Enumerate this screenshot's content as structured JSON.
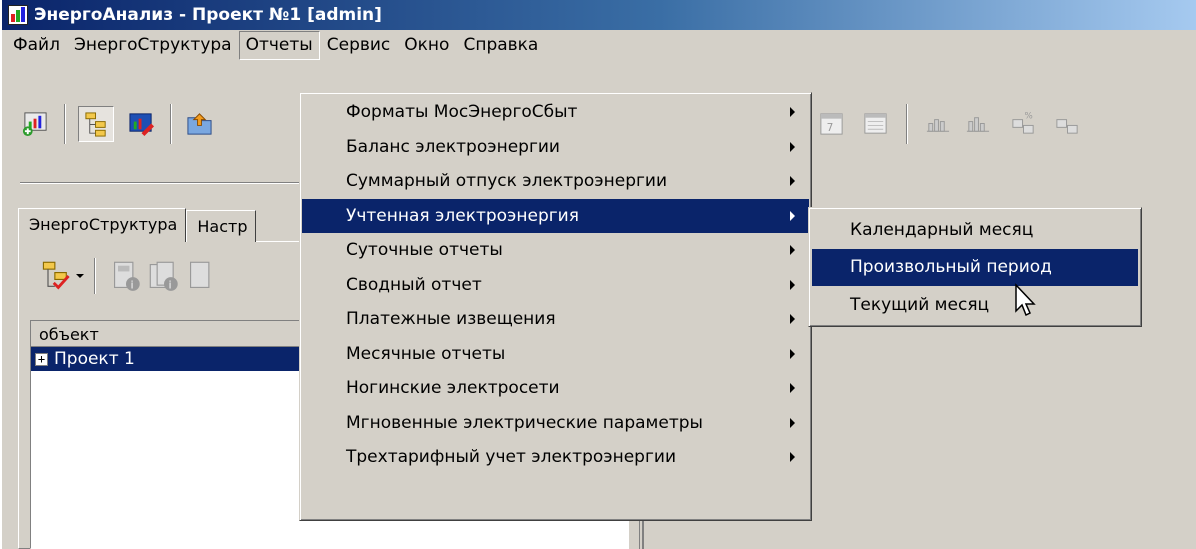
{
  "window": {
    "title": "ЭнергоАнализ - Проект №1 [admin]"
  },
  "menubar": [
    {
      "label": "Файл"
    },
    {
      "label": "ЭнергоСтруктура"
    },
    {
      "label": "Отчеты"
    },
    {
      "label": "Сервис"
    },
    {
      "label": "Окно"
    },
    {
      "label": "Справка"
    }
  ],
  "open_menu": "Отчеты",
  "dropdown": [
    {
      "label": "Форматы МосЭнергоСбыт"
    },
    {
      "label": "Баланс электроэнергии"
    },
    {
      "label": "Суммарный отпуск электроэнергии"
    },
    {
      "label": "Учтенная электроэнергия"
    },
    {
      "label": "Суточные отчеты"
    },
    {
      "label": "Сводный отчет"
    },
    {
      "label": "Платежные извещения"
    },
    {
      "label": "Месячные отчеты"
    },
    {
      "label": "Ногинские электросети"
    },
    {
      "label": "Мгновенные электрические параметры"
    },
    {
      "label": "Трехтарифный учет электроэнергии"
    }
  ],
  "highlighted_dropdown_item": "Учтенная электроэнергия",
  "submenu": [
    {
      "label": "Календарный месяц"
    },
    {
      "label": "Произвольный период"
    },
    {
      "label": "Текущий месяц"
    }
  ],
  "highlighted_submenu_item": "Произвольный период",
  "tabs": [
    {
      "label": "ЭнергоСтруктура"
    },
    {
      "label": "Настр"
    }
  ],
  "tree": {
    "column_header": "объект",
    "rows": [
      {
        "label": "Проект 1",
        "expander": "+"
      }
    ]
  },
  "colors": {
    "selection": "#0a246a",
    "face": "#d4d0c8",
    "title_start": "#0a246a",
    "title_end": "#a6caf0"
  }
}
